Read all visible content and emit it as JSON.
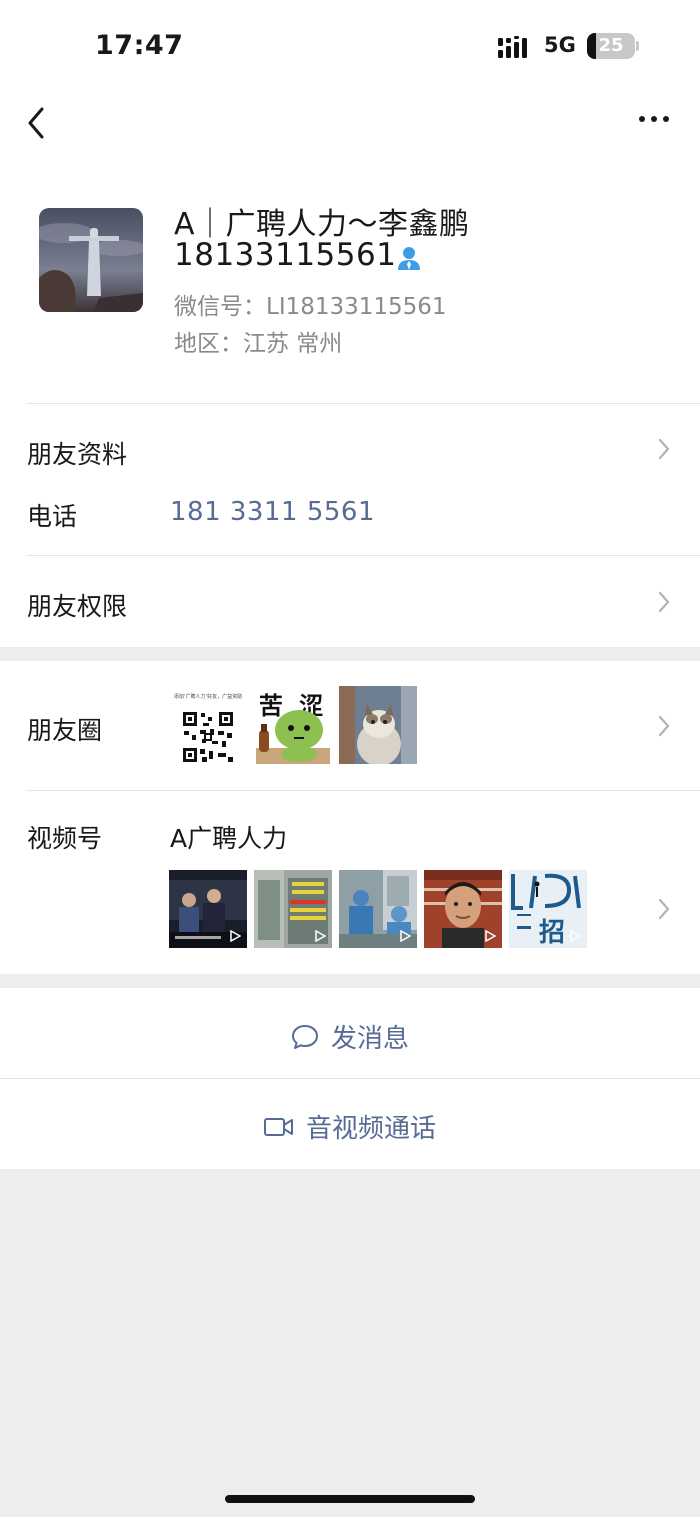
{
  "status_bar": {
    "time": "17:47",
    "network": "5G",
    "battery": "25"
  },
  "profile": {
    "name_line1": "A｜广聘人力～李鑫鹏",
    "name_line2": "18133115561",
    "wechat_id": "微信号：LI18133115561",
    "region": "地区：江苏 常州"
  },
  "info": {
    "friend_profile_label": "朋友资料",
    "phone_label": "电话",
    "phone_value": "181 3311 5561",
    "permissions_label": "朋友权限"
  },
  "moments": {
    "label": "朋友圈",
    "thumb1_caption": "添加‘广聘人力’好友，广益资助",
    "thumb2_text": "苦 涩"
  },
  "channels": {
    "label": "视频号",
    "name": "A广聘人力",
    "thumb5_text": "招"
  },
  "actions": {
    "message_label": "发消息",
    "call_label": "音视频通话"
  },
  "colors": {
    "link": "#576b95",
    "background": "#ededed",
    "card": "#ffffff"
  }
}
